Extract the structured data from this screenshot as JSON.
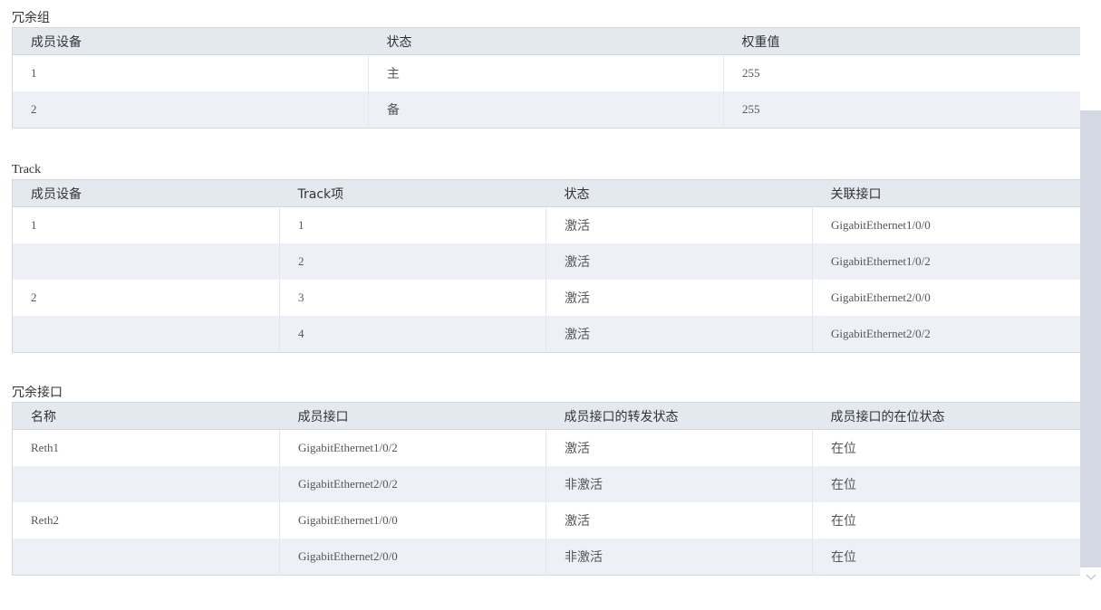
{
  "redundancy_group": {
    "title": "冗余组",
    "headers": [
      "成员设备",
      "状态",
      "权重值"
    ],
    "rows": [
      [
        "1",
        "主",
        "255"
      ],
      [
        "2",
        "备",
        "255"
      ]
    ]
  },
  "track": {
    "title": "Track",
    "headers": [
      "成员设备",
      "Track项",
      "状态",
      "关联接口"
    ],
    "rows": [
      [
        "1",
        "1",
        "激活",
        "GigabitEthernet1/0/0"
      ],
      [
        "",
        "2",
        "激活",
        "GigabitEthernet1/0/2"
      ],
      [
        "2",
        "3",
        "激活",
        "GigabitEthernet2/0/0"
      ],
      [
        "",
        "4",
        "激活",
        "GigabitEthernet2/0/2"
      ]
    ]
  },
  "redundant_interface": {
    "title": "冗余接口",
    "headers": [
      "名称",
      "成员接口",
      "成员接口的转发状态",
      "成员接口的在位状态"
    ],
    "rows": [
      [
        "Reth1",
        "GigabitEthernet1/0/2",
        "激活",
        "在位"
      ],
      [
        "",
        "GigabitEthernet2/0/2",
        "非激活",
        "在位"
      ],
      [
        "Reth2",
        "GigabitEthernet1/0/0",
        "激活",
        "在位"
      ],
      [
        "",
        "GigabitEthernet2/0/0",
        "非激活",
        "在位"
      ]
    ]
  },
  "icons": {
    "scroll_down": "chevron-down-icon"
  },
  "colors": {
    "header_bg": "#e4e9ef",
    "row_alt_bg": "#edf1f7",
    "border": "#d3d9e0",
    "scrollbar_thumb": "#d3d8e3"
  }
}
